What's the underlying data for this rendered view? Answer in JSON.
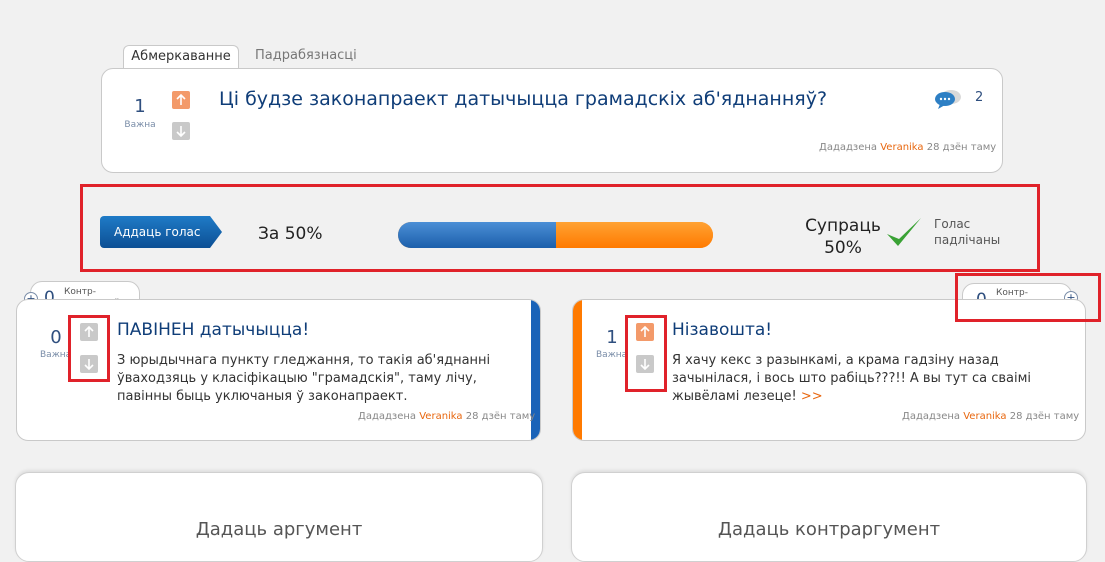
{
  "tabs": [
    {
      "label": "Абмеркаванне",
      "active": true
    },
    {
      "label": "Падрабязнасці",
      "active": false
    }
  ],
  "question": {
    "score": "1",
    "score_label": "Важна",
    "title": "Ці будзе законапраект датычыцца грамадскіх аб'яднанняў?",
    "comments_count": "2",
    "posted_prefix": "Дададзена",
    "author": "Veranika",
    "posted_time": "28 дзён таму"
  },
  "vote": {
    "button_label": "Аддаць голас",
    "for_label": "За 50%",
    "for_percent": 50,
    "against_label_line1": "Супраць",
    "against_label_line2": "50%",
    "voted_label": "Голас падлічаны"
  },
  "counter_left": {
    "count": "0",
    "label": "Контр-аргументаў"
  },
  "counter_right": {
    "count": "0",
    "label": "Контр-аргументаў"
  },
  "arg_left": {
    "score": "0",
    "score_label": "Важна",
    "title": "ПАВІНЕН датычыцца!",
    "text": "З юрыдычнага пункту гледжання, то такія аб'яднанні ўваходзяць у класіфікацыю \"грамадскія\", таму лічу, павінны быць уключаныя ў законапраект.",
    "posted_prefix": "Дададзена",
    "author": "Veranika",
    "posted_time": "28 дзён таму"
  },
  "arg_right": {
    "score": "1",
    "score_label": "Важна",
    "title": "Нізавошта!",
    "text": "Я хачу кекс з разынкамі, а крама гадзіну назад зачынілася, і вось што рабіць???!! А вы тут са сваімі жывёламі лезеце!",
    "more": ">>",
    "posted_prefix": "Дададзена",
    "author": "Veranika",
    "posted_time": "28 дзён таму"
  },
  "add_argument": "Дадаць аргумент",
  "add_counterargument": "Дадаць контраргумент",
  "colors": {
    "for_blue": "#1c5fab",
    "against_orange": "#ff7a00",
    "highlight_red": "#e0222a",
    "accent_orange": "#e8670f",
    "title_blue": "#0f3d78"
  },
  "icons": {
    "vote_up": "arrow-up-icon",
    "vote_down": "arrow-down-icon",
    "comments": "speech-bubbles-icon",
    "voted": "checkmark-icon",
    "add": "plus-icon"
  }
}
